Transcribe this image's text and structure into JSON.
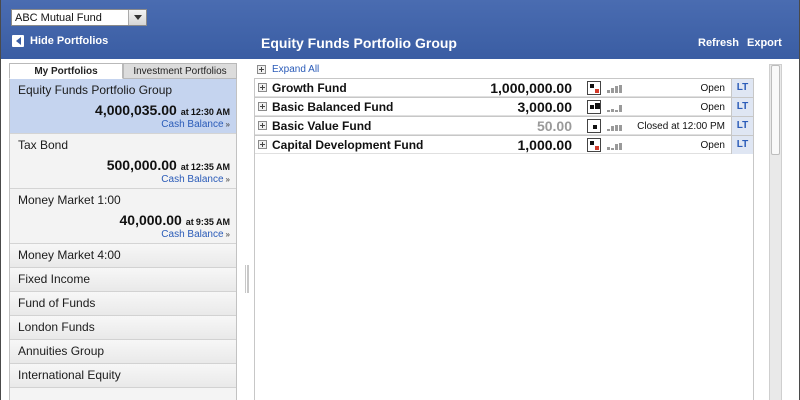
{
  "header": {
    "fund_select": "ABC Mutual Fund",
    "hide_label": "Hide Portfolios",
    "title": "Equity Funds Portfolio Group",
    "refresh_label": "Refresh",
    "export_label": "Export"
  },
  "sidebar": {
    "tabs": [
      "My Portfolios",
      "Investment Portfolios"
    ],
    "active_tab": "My Portfolios",
    "portfolios": [
      {
        "name": "Equity Funds Portfolio Group",
        "amount": "4,000,035.00",
        "at": "at",
        "time": "12:30 AM",
        "cash": "Cash Balance",
        "selected": true
      },
      {
        "name": "Tax Bond",
        "amount": "500,000.00",
        "at": "at",
        "time": "12:35 AM",
        "cash": "Cash Balance",
        "selected": false
      },
      {
        "name": "Money Market 1:00",
        "amount": "40,000.00",
        "at": "at",
        "time": "9:35 AM",
        "cash": "Cash Balance",
        "selected": false
      }
    ],
    "items": [
      "Money Market 4:00",
      "Fixed Income",
      "Fund of Funds",
      "London Funds",
      "Annuities Group",
      "International Equity"
    ]
  },
  "main": {
    "expand_all": "Expand All",
    "funds": [
      {
        "name": "Growth Fund",
        "amount": "1,000,000.00",
        "status": "Open",
        "lt": "LT",
        "muted": false
      },
      {
        "name": "Basic Balanced Fund",
        "amount": "3,000.00",
        "status": "Open",
        "lt": "LT",
        "muted": false
      },
      {
        "name": "Basic Value Fund",
        "amount": "50.00",
        "status": "Closed at 12:00 PM",
        "lt": "LT",
        "muted": true
      },
      {
        "name": "Capital Development Fund",
        "amount": "1,000.00",
        "status": "Open",
        "lt": "LT",
        "muted": false
      }
    ]
  },
  "colors": {
    "header_blue": "#3f62a8",
    "selected_row": "#c5d4ef",
    "link_blue": "#2a5bb8",
    "indicator_red": "#d43a2a"
  }
}
